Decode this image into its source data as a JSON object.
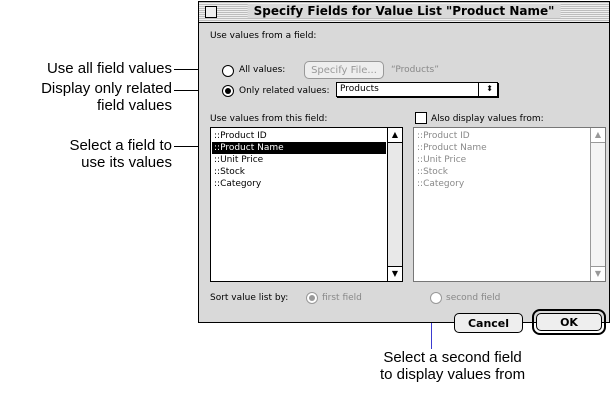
{
  "dialog": {
    "title": "Specify Fields for Value List \"Product Name\"",
    "section_label": "Use values from a field:",
    "all_values_label": "All values:",
    "specify_file_label": "Specify File...",
    "file_name": "“Products”",
    "only_related_label": "Only related values:",
    "relationship_value": "Products",
    "use_values_label": "Use values from this field:",
    "also_display_label": "Also display values from:",
    "fields": [
      "::Product ID",
      "::Product Name",
      "::Unit Price",
      "::Stock",
      "::Category"
    ],
    "selected_field": "::Product Name",
    "second_fields": [
      "::Product ID",
      "::Product Name",
      "::Unit Price",
      "::Stock",
      "::Category"
    ],
    "sort_label": "Sort value list by:",
    "sort_first_label": "first field",
    "sort_second_label": "second field",
    "cancel_label": "Cancel",
    "ok_label": "OK"
  },
  "callouts": {
    "all_values": "Use all field values",
    "related_line1": "Display only related",
    "related_line2": "field values",
    "select_line1": "Select a field to",
    "select_line2": "use its values",
    "second_line1": "Select a second field",
    "second_line2": "to display values from"
  }
}
